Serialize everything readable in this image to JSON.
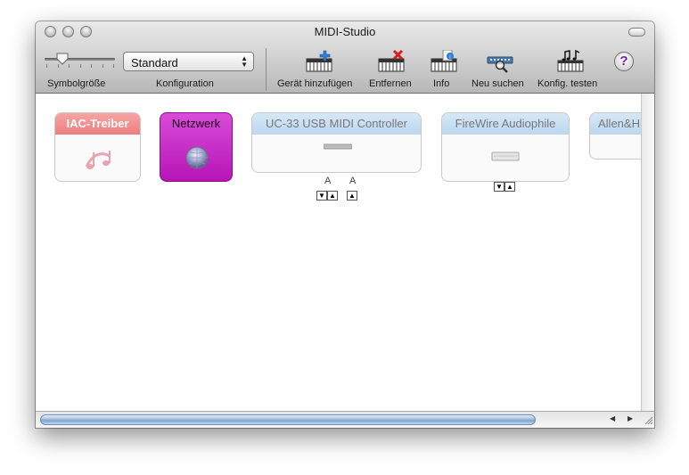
{
  "window": {
    "title": "MIDI-Studio"
  },
  "toolbar": {
    "symbol_size_label": "Symbolgröße",
    "config_label": "Konfiguration",
    "config_value": "Standard",
    "add_device_label": "Gerät hinzufügen",
    "remove_label": "Entfernen",
    "info_label": "Info",
    "rescan_label": "Neu suchen",
    "test_setup_label": "Konfig. testen",
    "help_glyph": "?"
  },
  "devices": [
    {
      "name": "IAC-Treiber",
      "color": "#f28a8a"
    },
    {
      "name": "Netzwerk",
      "color": "#cc22cc"
    },
    {
      "name": "UC-33 USB MIDI Controller",
      "color": "#c7dff2",
      "ports": [
        "A",
        "A"
      ]
    },
    {
      "name": "FireWire Audiophile",
      "color": "#c7dff2"
    },
    {
      "name": "Allen&H",
      "color": "#c7dff2"
    }
  ],
  "accent": "#7fa3d0"
}
